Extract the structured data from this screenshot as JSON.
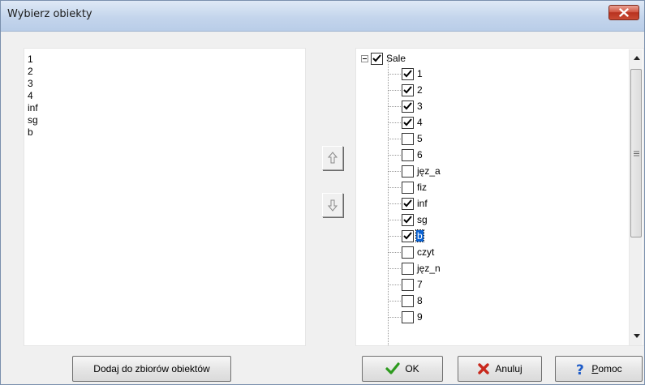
{
  "window": {
    "title": "Wybierz obiekty"
  },
  "list": {
    "items": [
      "1",
      "2",
      "3",
      "4",
      "inf",
      "sg",
      "b"
    ]
  },
  "tree": {
    "root": {
      "label": "Sale",
      "checked": true,
      "expanded": true
    },
    "children": [
      {
        "label": "1",
        "checked": true
      },
      {
        "label": "2",
        "checked": true
      },
      {
        "label": "3",
        "checked": true
      },
      {
        "label": "4",
        "checked": true
      },
      {
        "label": "5",
        "checked": false
      },
      {
        "label": "6",
        "checked": false
      },
      {
        "label": "jęz_a",
        "checked": false
      },
      {
        "label": "fiz",
        "checked": false
      },
      {
        "label": "inf",
        "checked": true
      },
      {
        "label": "sg",
        "checked": true
      },
      {
        "label": "b",
        "checked": true,
        "selected": true
      },
      {
        "label": "czyt",
        "checked": false
      },
      {
        "label": "jęz_n",
        "checked": false
      },
      {
        "label": "7",
        "checked": false
      },
      {
        "label": "8",
        "checked": false
      },
      {
        "label": "9",
        "checked": false
      }
    ]
  },
  "buttons": {
    "add": "Dodaj do zbiorów obiektów",
    "ok": "OK",
    "cancel": "Anuluj",
    "help_prefix": "",
    "help_underlined": "P",
    "help_rest": "omoc"
  },
  "colors": {
    "ok_check": "#2d9a1e",
    "cancel_x": "#c8281c",
    "help_q": "#1e5cc8",
    "selection": "#0a62d3"
  }
}
